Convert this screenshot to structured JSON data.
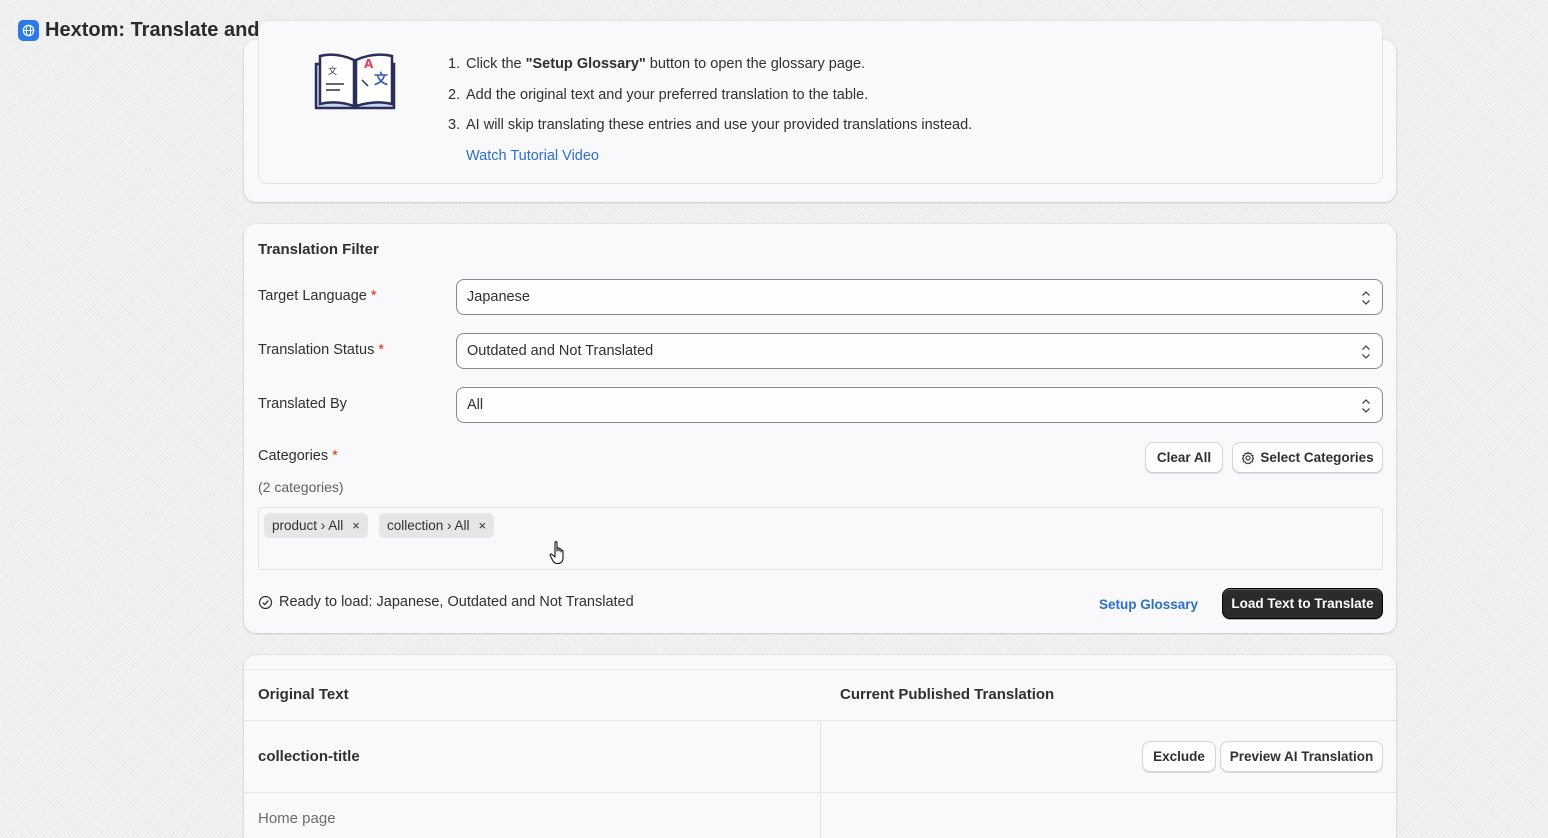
{
  "app": {
    "title": "Hextom: Translate and Currency",
    "icon": "globe-icon"
  },
  "glossary": {
    "steps": [
      {
        "num": "1.",
        "before": "Click the ",
        "bold": "\"Setup Glossary\"",
        "after": " button to open the glossary page."
      },
      {
        "num": "2.",
        "text": "Add the original text and your preferred translation to the table."
      },
      {
        "num": "3.",
        "text": "AI will skip translating these entries and use your provided translations instead."
      }
    ],
    "watch_link": "Watch Tutorial Video"
  },
  "filter": {
    "title": "Translation Filter",
    "target_language": {
      "label": "Target Language",
      "required": "*",
      "value": "Japanese"
    },
    "translation_status": {
      "label": "Translation Status",
      "required": "*",
      "value": "Outdated and Not Translated"
    },
    "translated_by": {
      "label": "Translated By",
      "value": "All"
    },
    "categories": {
      "label": "Categories",
      "required": "*",
      "count_text": "(2 categories)",
      "clear_all": "Clear All",
      "select_categories": "Select Categories",
      "tags": [
        {
          "label": "product › All",
          "remove": "×"
        },
        {
          "label": "collection › All",
          "remove": "×"
        }
      ]
    },
    "status_text": "Ready to load: Japanese, Outdated and Not Translated",
    "setup_glossary": "Setup Glossary",
    "load_button": "Load Text to Translate"
  },
  "table": {
    "headers": [
      "Original Text",
      "Current Published Translation"
    ],
    "row": {
      "key": "collection-title",
      "exclude": "Exclude",
      "preview": "Preview AI Translation",
      "original": "Home page"
    }
  },
  "colors": {
    "accent": "#2c6ecb",
    "primary_button": "#2b2b2b",
    "required": "#d72c0d",
    "app_icon": "#2c7be5"
  }
}
